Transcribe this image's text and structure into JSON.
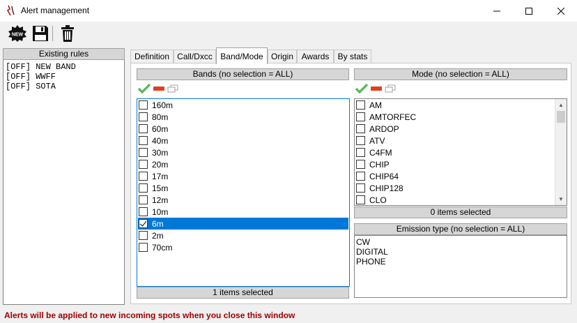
{
  "window": {
    "title": "Alert management"
  },
  "toolbar": {
    "new_label": "NEW"
  },
  "rules": {
    "header": "Existing rules",
    "items": [
      "[OFF] NEW BAND",
      "[OFF] WWFF",
      "[OFF] SOTA"
    ]
  },
  "tabs": [
    "Definition",
    "Call/Dxcc",
    "Band/Mode",
    "Origin",
    "Awards",
    "By stats"
  ],
  "active_tab": "Band/Mode",
  "bands": {
    "header": "Bands (no selection = ALL)",
    "items": [
      {
        "label": "160m",
        "checked": false
      },
      {
        "label": "80m",
        "checked": false
      },
      {
        "label": "60m",
        "checked": false
      },
      {
        "label": "40m",
        "checked": false
      },
      {
        "label": "30m",
        "checked": false
      },
      {
        "label": "20m",
        "checked": false
      },
      {
        "label": "17m",
        "checked": false
      },
      {
        "label": "15m",
        "checked": false
      },
      {
        "label": "12m",
        "checked": false
      },
      {
        "label": "10m",
        "checked": false
      },
      {
        "label": "6m",
        "checked": true,
        "selected": true
      },
      {
        "label": "2m",
        "checked": false
      },
      {
        "label": "70cm",
        "checked": false
      }
    ],
    "footer": "1 items selected"
  },
  "mode": {
    "header": "Mode (no selection = ALL)",
    "items": [
      "AM",
      "AMTORFEC",
      "ARDOP",
      "ATV",
      "C4FM",
      "CHIP",
      "CHIP64",
      "CHIP128",
      "CLO"
    ],
    "footer": "0 items selected"
  },
  "emission": {
    "header": "Emission type (no selection = ALL)",
    "items": [
      "CW",
      "DIGITAL",
      "PHONE"
    ]
  },
  "status": {
    "message": "Alerts will be applied to new incoming spots when you close this window"
  },
  "colors": {
    "selection": "#0078d7",
    "status_text": "#a00000",
    "header_bg": "#d6d6d6"
  }
}
